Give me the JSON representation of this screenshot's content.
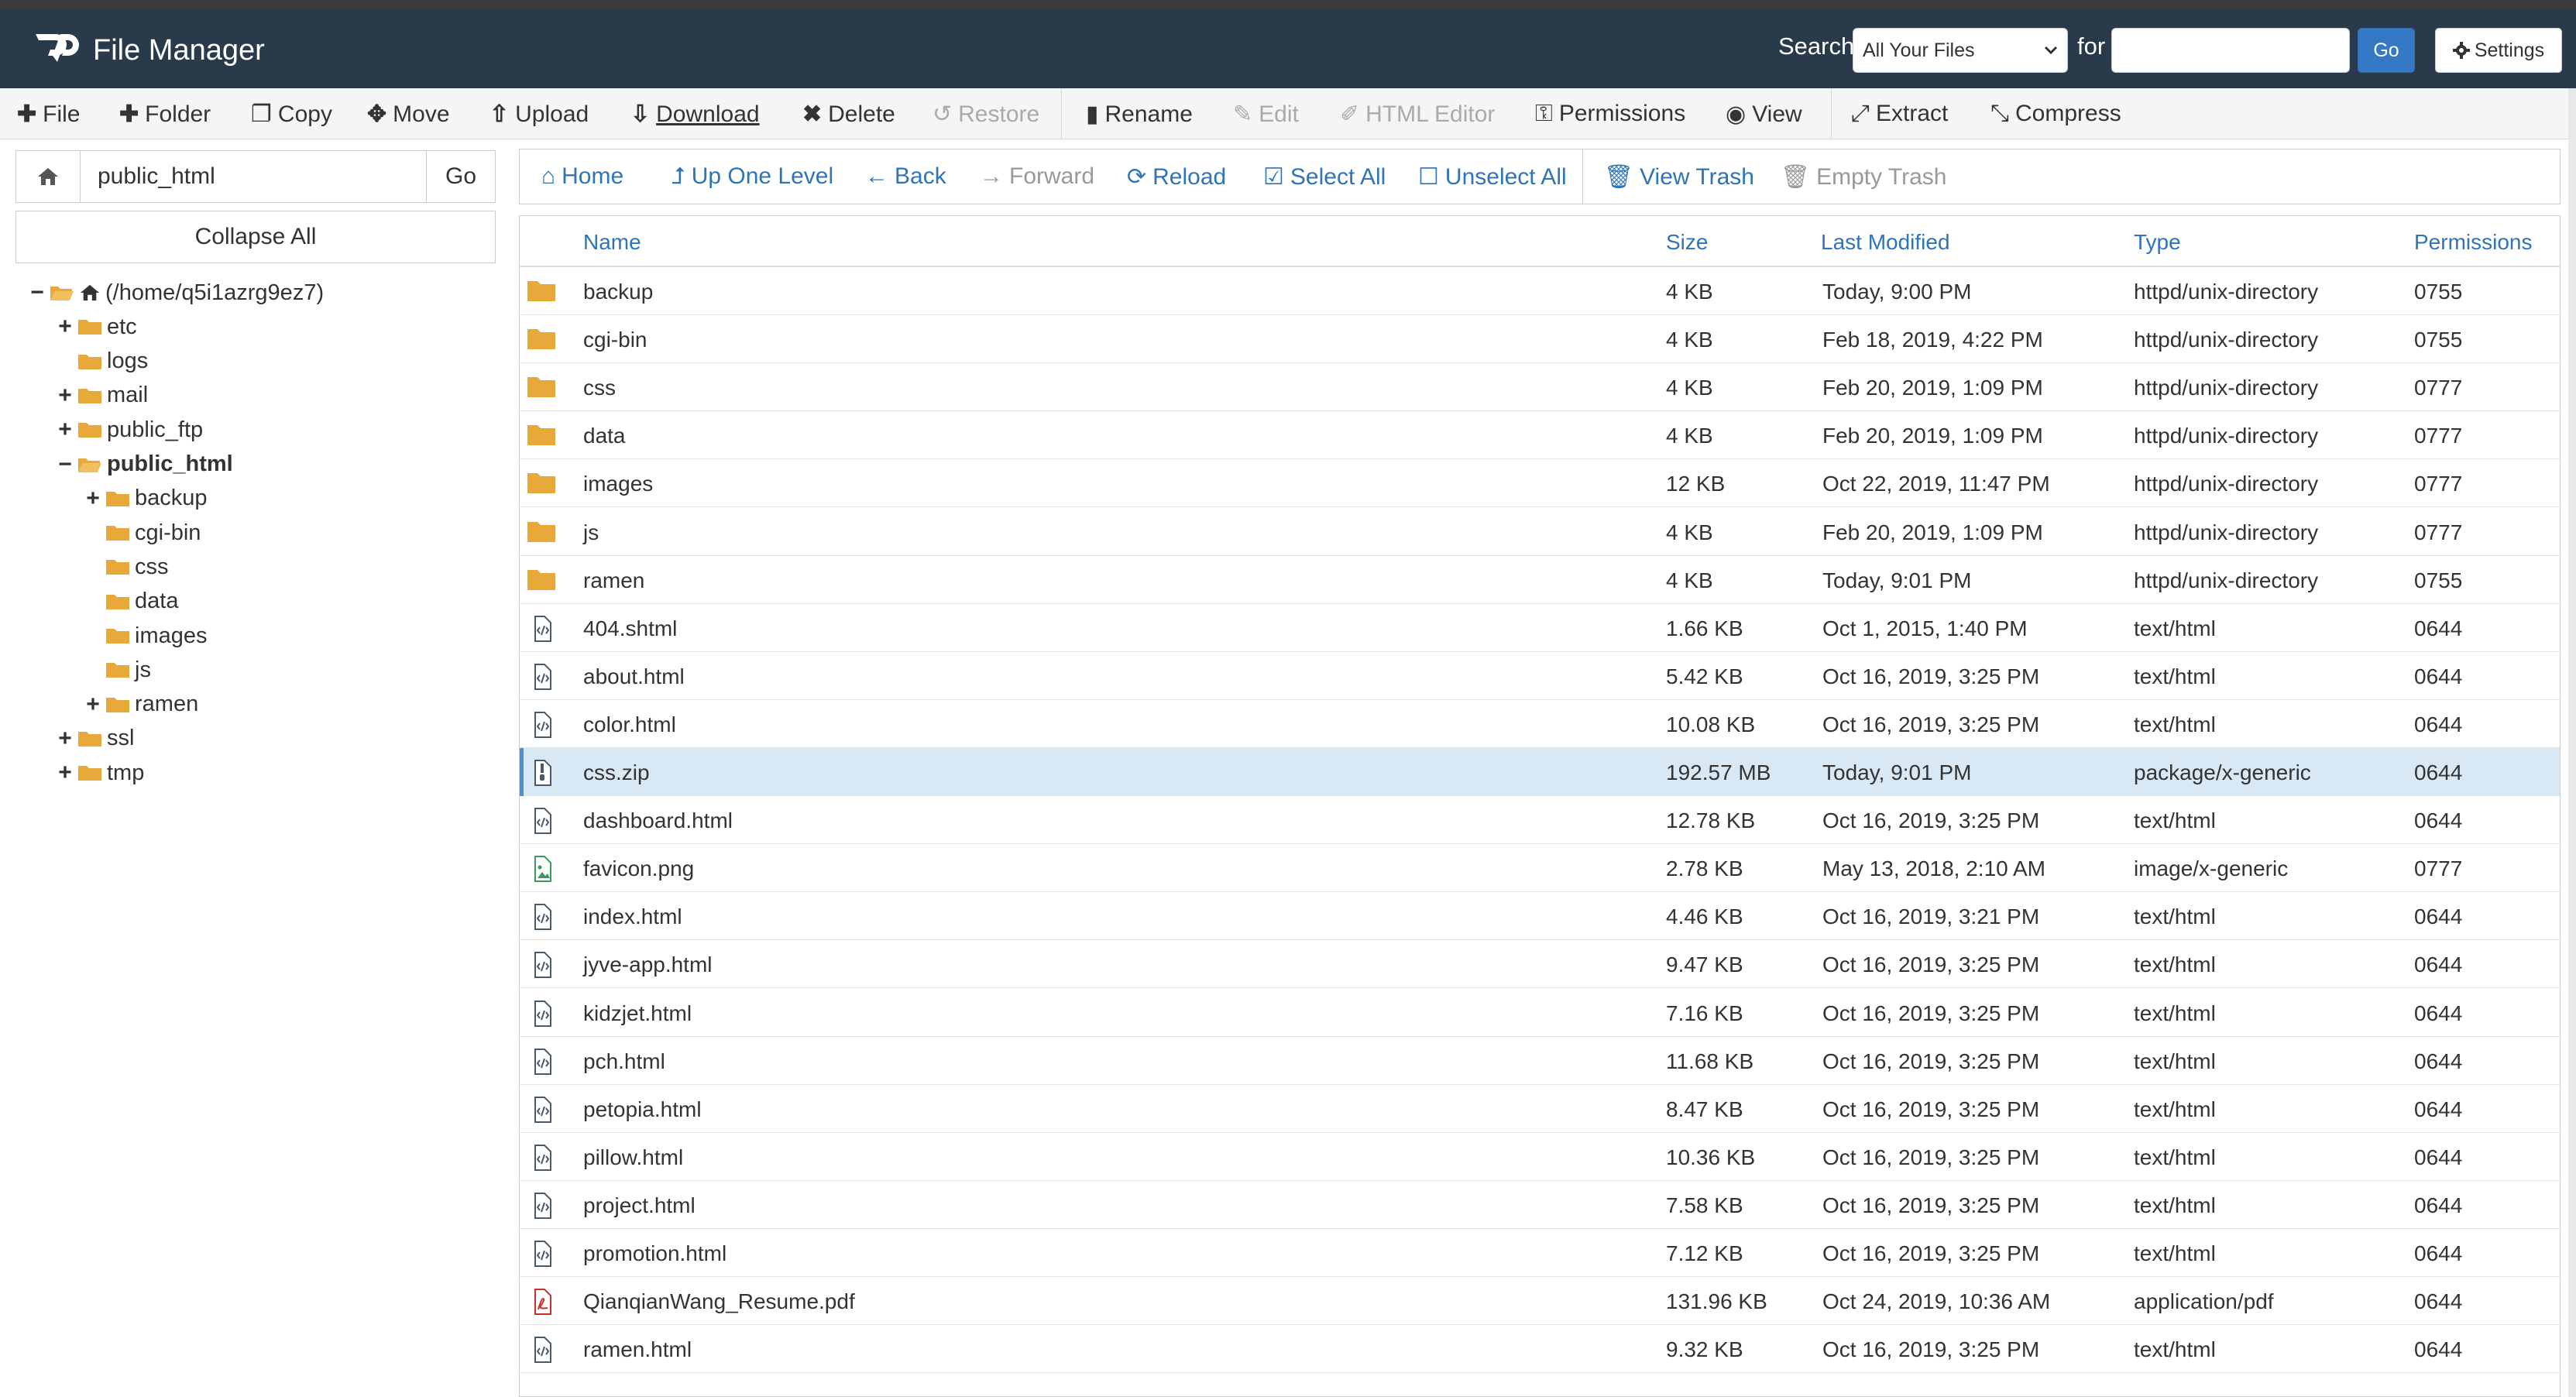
{
  "app": {
    "title": "File Manager"
  },
  "header": {
    "search_label": "Search",
    "search_scope": "All Your Files",
    "for_label": "for",
    "search_value": "",
    "go_label": "Go",
    "settings_label": "Settings"
  },
  "toolbar": {
    "items": [
      {
        "label": "File",
        "icon": "plus-icon",
        "enabled": true
      },
      {
        "label": "Folder",
        "icon": "plus-icon",
        "enabled": true
      },
      {
        "label": "Copy",
        "icon": "copy-icon",
        "enabled": true
      },
      {
        "label": "Move",
        "icon": "move-icon",
        "enabled": true
      },
      {
        "label": "Upload",
        "icon": "upload-icon",
        "enabled": true
      },
      {
        "label": "Download",
        "icon": "download-icon",
        "enabled": true
      },
      {
        "label": "Delete",
        "icon": "close-icon",
        "enabled": true
      },
      {
        "label": "Restore",
        "icon": "undo-icon",
        "enabled": false
      },
      {
        "label": "Rename",
        "icon": "file-icon",
        "enabled": true
      },
      {
        "label": "Edit",
        "icon": "pencil-icon",
        "enabled": false
      },
      {
        "label": "HTML Editor",
        "icon": "edit-square-icon",
        "enabled": false
      },
      {
        "label": "Permissions",
        "icon": "key-icon",
        "enabled": true
      },
      {
        "label": "View",
        "icon": "eye-icon",
        "enabled": true
      },
      {
        "label": "Extract",
        "icon": "expand-icon",
        "enabled": true
      },
      {
        "label": "Compress",
        "icon": "compress-icon",
        "enabled": true
      }
    ]
  },
  "sidebar": {
    "path_value": "public_html",
    "go_label": "Go",
    "collapse_label": "Collapse All",
    "tree": [
      {
        "label": "(/home/q5i1azrg9ez7)",
        "sign": "−",
        "level": 0,
        "open": true,
        "home": true
      },
      {
        "label": "etc",
        "sign": "+",
        "level": 1
      },
      {
        "label": "logs",
        "sign": "",
        "level": 1
      },
      {
        "label": "mail",
        "sign": "+",
        "level": 1
      },
      {
        "label": "public_ftp",
        "sign": "+",
        "level": 1
      },
      {
        "label": "public_html",
        "sign": "−",
        "level": 1,
        "open": true,
        "active": true
      },
      {
        "label": "backup",
        "sign": "+",
        "level": 2
      },
      {
        "label": "cgi-bin",
        "sign": "",
        "level": 2
      },
      {
        "label": "css",
        "sign": "",
        "level": 2
      },
      {
        "label": "data",
        "sign": "",
        "level": 2
      },
      {
        "label": "images",
        "sign": "",
        "level": 2
      },
      {
        "label": "js",
        "sign": "",
        "level": 2
      },
      {
        "label": "ramen",
        "sign": "+",
        "level": 2
      },
      {
        "label": "ssl",
        "sign": "+",
        "level": 1
      },
      {
        "label": "tmp",
        "sign": "+",
        "level": 1
      }
    ]
  },
  "nav": {
    "items": [
      {
        "label": "Home",
        "icon": "home-icon",
        "enabled": true
      },
      {
        "label": "Up One Level",
        "icon": "level-up-icon",
        "enabled": true
      },
      {
        "label": "Back",
        "icon": "arrow-left-icon",
        "enabled": true
      },
      {
        "label": "Forward",
        "icon": "arrow-right-icon",
        "enabled": false
      },
      {
        "label": "Reload",
        "icon": "refresh-icon",
        "enabled": true
      },
      {
        "label": "Select All",
        "icon": "checkbox-checked-icon",
        "enabled": true
      },
      {
        "label": "Unselect All",
        "icon": "checkbox-empty-icon",
        "enabled": true
      },
      {
        "label": "View Trash",
        "icon": "trash-icon",
        "enabled": true
      },
      {
        "label": "Empty Trash",
        "icon": "trash-icon",
        "enabled": false
      }
    ]
  },
  "table": {
    "columns": [
      "Name",
      "Size",
      "Last Modified",
      "Type",
      "Permissions"
    ],
    "rows": [
      {
        "icon": "folder",
        "name": "backup",
        "size": "4 KB",
        "modified": "Today, 9:00 PM",
        "type": "httpd/unix-directory",
        "perms": "0755"
      },
      {
        "icon": "folder",
        "name": "cgi-bin",
        "size": "4 KB",
        "modified": "Feb 18, 2019, 4:22 PM",
        "type": "httpd/unix-directory",
        "perms": "0755"
      },
      {
        "icon": "folder",
        "name": "css",
        "size": "4 KB",
        "modified": "Feb 20, 2019, 1:09 PM",
        "type": "httpd/unix-directory",
        "perms": "0777"
      },
      {
        "icon": "folder",
        "name": "data",
        "size": "4 KB",
        "modified": "Feb 20, 2019, 1:09 PM",
        "type": "httpd/unix-directory",
        "perms": "0777"
      },
      {
        "icon": "folder",
        "name": "images",
        "size": "12 KB",
        "modified": "Oct 22, 2019, 11:47 PM",
        "type": "httpd/unix-directory",
        "perms": "0777"
      },
      {
        "icon": "folder",
        "name": "js",
        "size": "4 KB",
        "modified": "Feb 20, 2019, 1:09 PM",
        "type": "httpd/unix-directory",
        "perms": "0777"
      },
      {
        "icon": "folder",
        "name": "ramen",
        "size": "4 KB",
        "modified": "Today, 9:01 PM",
        "type": "httpd/unix-directory",
        "perms": "0755"
      },
      {
        "icon": "code",
        "name": "404.shtml",
        "size": "1.66 KB",
        "modified": "Oct 1, 2015, 1:40 PM",
        "type": "text/html",
        "perms": "0644"
      },
      {
        "icon": "code",
        "name": "about.html",
        "size": "5.42 KB",
        "modified": "Oct 16, 2019, 3:25 PM",
        "type": "text/html",
        "perms": "0644"
      },
      {
        "icon": "code",
        "name": "color.html",
        "size": "10.08 KB",
        "modified": "Oct 16, 2019, 3:25 PM",
        "type": "text/html",
        "perms": "0644"
      },
      {
        "icon": "zip",
        "name": "css.zip",
        "size": "192.57 MB",
        "modified": "Today, 9:01 PM",
        "type": "package/x-generic",
        "perms": "0644",
        "selected": true
      },
      {
        "icon": "code",
        "name": "dashboard.html",
        "size": "12.78 KB",
        "modified": "Oct 16, 2019, 3:25 PM",
        "type": "text/html",
        "perms": "0644"
      },
      {
        "icon": "image",
        "name": "favicon.png",
        "size": "2.78 KB",
        "modified": "May 13, 2018, 2:10 AM",
        "type": "image/x-generic",
        "perms": "0777"
      },
      {
        "icon": "code",
        "name": "index.html",
        "size": "4.46 KB",
        "modified": "Oct 16, 2019, 3:21 PM",
        "type": "text/html",
        "perms": "0644"
      },
      {
        "icon": "code",
        "name": "jyve-app.html",
        "size": "9.47 KB",
        "modified": "Oct 16, 2019, 3:25 PM",
        "type": "text/html",
        "perms": "0644"
      },
      {
        "icon": "code",
        "name": "kidzjet.html",
        "size": "7.16 KB",
        "modified": "Oct 16, 2019, 3:25 PM",
        "type": "text/html",
        "perms": "0644"
      },
      {
        "icon": "code",
        "name": "pch.html",
        "size": "11.68 KB",
        "modified": "Oct 16, 2019, 3:25 PM",
        "type": "text/html",
        "perms": "0644"
      },
      {
        "icon": "code",
        "name": "petopia.html",
        "size": "8.47 KB",
        "modified": "Oct 16, 2019, 3:25 PM",
        "type": "text/html",
        "perms": "0644"
      },
      {
        "icon": "code",
        "name": "pillow.html",
        "size": "10.36 KB",
        "modified": "Oct 16, 2019, 3:25 PM",
        "type": "text/html",
        "perms": "0644"
      },
      {
        "icon": "code",
        "name": "project.html",
        "size": "7.58 KB",
        "modified": "Oct 16, 2019, 3:25 PM",
        "type": "text/html",
        "perms": "0644"
      },
      {
        "icon": "code",
        "name": "promotion.html",
        "size": "7.12 KB",
        "modified": "Oct 16, 2019, 3:25 PM",
        "type": "text/html",
        "perms": "0644"
      },
      {
        "icon": "pdf",
        "name": "QianqianWang_Resume.pdf",
        "size": "131.96 KB",
        "modified": "Oct 24, 2019, 10:36 AM",
        "type": "application/pdf",
        "perms": "0644"
      },
      {
        "icon": "code",
        "name": "ramen.html",
        "size": "9.32 KB",
        "modified": "Oct 16, 2019, 3:25 PM",
        "type": "text/html",
        "perms": "0644"
      }
    ]
  },
  "colors": {
    "header_bg": "#293a4a",
    "link_blue": "#2f74b5",
    "folder": "#e8a93b",
    "selected_row": "#d9e8f5",
    "pdf_red": "#c9302c",
    "image_green": "#3a9b5c"
  }
}
